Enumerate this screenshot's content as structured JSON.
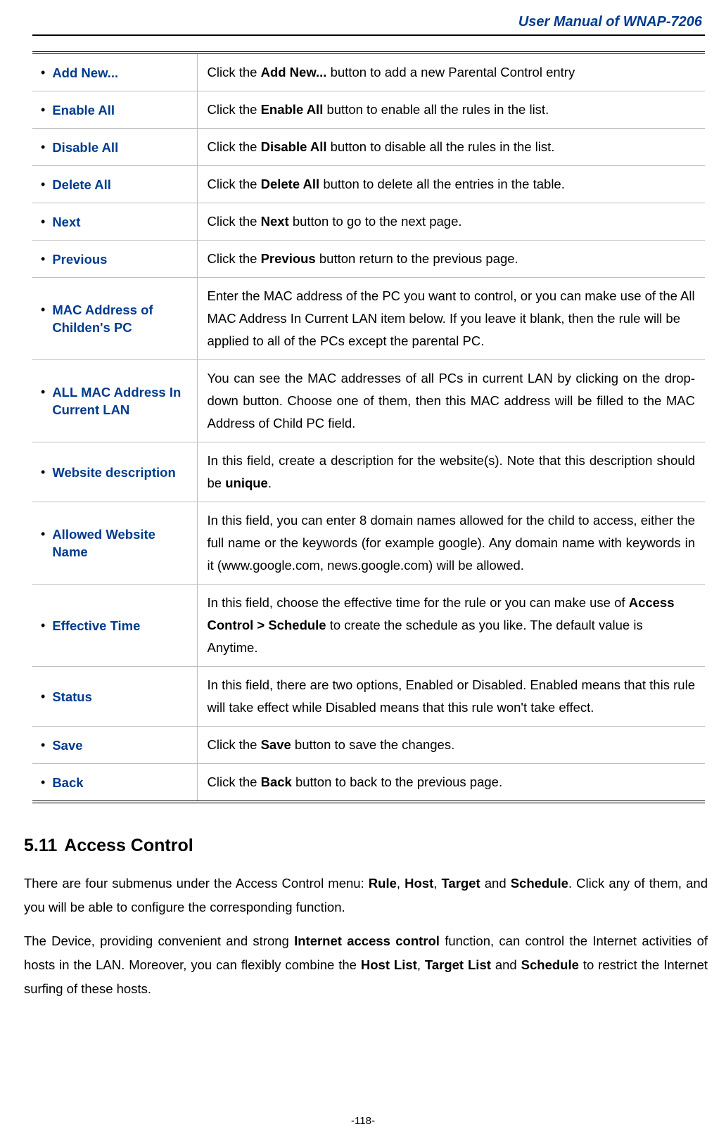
{
  "header": {
    "title": "User Manual of WNAP-7206"
  },
  "table": {
    "rows": [
      {
        "term": "Add New...",
        "desc_parts": [
          "Click the ",
          "Add New...",
          " button to add a new Parental Control entry"
        ],
        "bold": [
          1
        ]
      },
      {
        "term": "Enable All",
        "desc_parts": [
          "Click the ",
          "Enable All",
          " button to enable all the rules in the list."
        ],
        "bold": [
          1
        ]
      },
      {
        "term": "Disable All",
        "desc_parts": [
          "Click the ",
          "Disable All",
          " button to disable all the rules in the list."
        ],
        "bold": [
          1
        ]
      },
      {
        "term": "Delete All",
        "desc_parts": [
          "Click the ",
          "Delete All",
          " button to delete all the entries in the table."
        ],
        "bold": [
          1
        ]
      },
      {
        "term": "Next",
        "desc_parts": [
          "Click the ",
          "Next",
          " button to go to the next page."
        ],
        "bold": [
          1
        ]
      },
      {
        "term": "Previous",
        "desc_parts": [
          "Click the ",
          "Previous",
          " button return to the previous page."
        ],
        "bold": [
          1
        ]
      },
      {
        "term": "MAC Address of Childen's PC",
        "desc_parts": [
          "Enter the MAC address of the PC you want to control, or you can make use of the All MAC Address In Current LAN item below. If you leave it blank, then the rule will be applied to all of the PCs except the parental PC."
        ],
        "bold": []
      },
      {
        "term": "ALL MAC Address In Current LAN",
        "desc_parts": [
          "You can see the MAC addresses of all PCs in current LAN by clicking on the drop-down button. Choose one of them, then this MAC address will be filled to the MAC Address of Child PC field."
        ],
        "bold": [],
        "justify": true
      },
      {
        "term": "Website description",
        "desc_parts": [
          "In this field, create a description for the website(s). Note that this description should be ",
          "unique",
          "."
        ],
        "bold": [
          1
        ],
        "justify": true
      },
      {
        "term": "Allowed Website Name",
        "desc_parts": [
          "In this field, you can enter 8 domain names allowed for the child to access, either the full name or the keywords (for example google). Any domain name with keywords in it (www.google.com, news.google.com) will be allowed."
        ],
        "bold": [],
        "justify": true
      },
      {
        "term": "Effective Time",
        "desc_parts": [
          "In this field, choose the effective time for the rule or you can make use of ",
          "Access Control > Schedule",
          " to create the schedule as you like. The default value is Anytime."
        ],
        "bold": [
          1
        ]
      },
      {
        "term": "Status",
        "desc_parts": [
          "In this field, there are two options, Enabled or Disabled. Enabled means that this rule will take effect while Disabled means that this rule won't take effect."
        ],
        "bold": [],
        "justify": true
      },
      {
        "term": "Save",
        "desc_parts": [
          "Click the ",
          "Save",
          " button to save the changes."
        ],
        "bold": [
          1
        ]
      },
      {
        "term": "Back",
        "desc_parts": [
          "Click the ",
          "Back",
          " button to back to the previous page."
        ],
        "bold": [
          1
        ]
      }
    ]
  },
  "section": {
    "number": "5.11",
    "title": "Access Control"
  },
  "paragraphs": [
    {
      "parts": [
        "There are four submenus under the Access Control menu: ",
        "Rule",
        ", ",
        "Host",
        ", ",
        "Target",
        " and ",
        "Schedule",
        ". Click any of them, and you will be able to configure the corresponding function."
      ],
      "bold": [
        1,
        3,
        5,
        7
      ]
    },
    {
      "parts": [
        "The Device, providing convenient and strong ",
        "Internet access control",
        " function, can control the Internet activities of hosts in the LAN. Moreover, you can flexibly combine the ",
        "Host List",
        ", ",
        "Target List",
        " and ",
        "Schedule",
        " to restrict the Internet surfing of these hosts."
      ],
      "bold": [
        1,
        3,
        5,
        7
      ]
    }
  ],
  "page_number": "-118-"
}
